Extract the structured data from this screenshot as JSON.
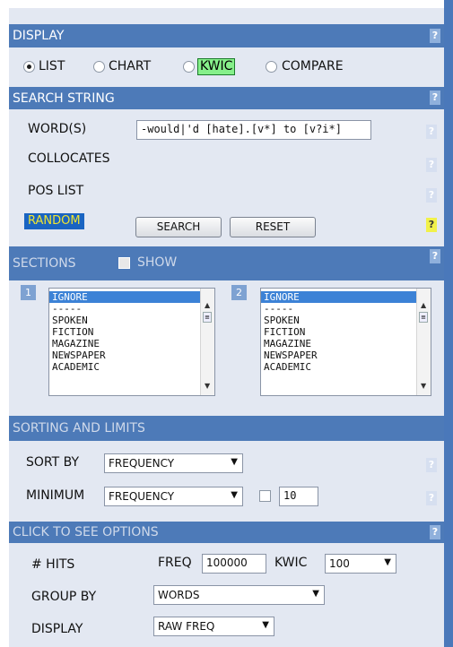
{
  "display": {
    "title": "DISPLAY",
    "help": "?",
    "options": [
      {
        "label": "LIST",
        "checked": true
      },
      {
        "label": "CHART",
        "checked": false
      },
      {
        "label": "KWIC",
        "checked": false
      },
      {
        "label": "COMPARE",
        "checked": false
      }
    ]
  },
  "search": {
    "title": "SEARCH STRING",
    "help": "?",
    "words_label": "WORD(S)",
    "words_value": "-would|'d [hate].[v*] to [v?i*]",
    "collocates_label": "COLLOCATES",
    "pos_list_label": "POS LIST",
    "random_label": "RANDOM",
    "search_button": "SEARCH",
    "reset_button": "RESET"
  },
  "sections": {
    "title": "SECTIONS",
    "show_label": "SHOW",
    "help": "?",
    "list1_number": "1",
    "list2_number": "2",
    "list_items": [
      "IGNORE",
      "-----",
      "SPOKEN",
      "FICTION",
      "MAGAZINE",
      "NEWSPAPER",
      "ACADEMIC"
    ],
    "selected_item": "IGNORE"
  },
  "sorting": {
    "title": "SORTING AND LIMITS",
    "sort_label": "SORT BY",
    "sort_value": "FREQUENCY",
    "minimum_label": "MINIMUM",
    "minimum_value": "FREQUENCY",
    "minimum_number": "10",
    "help": "?"
  },
  "options": {
    "title": "CLICK TO SEE OPTIONS",
    "help": "?",
    "hits_label": "# HITS",
    "freq_label": "FREQ",
    "freq_value": "100000",
    "kwic_label": "KWIC",
    "kwic_value": "100",
    "group_label": "GROUP BY",
    "group_value": "WORDS",
    "display_label": "DISPLAY",
    "display_value": "RAW FREQ"
  },
  "colors": {
    "header_blue": "#4d7ab8",
    "panel_bg": "#e3e8f2",
    "kwic_green": "#86f08a",
    "random_bg": "#1a64c2",
    "random_text": "#f0e430",
    "selected_item_bg": "#3c82d6"
  }
}
